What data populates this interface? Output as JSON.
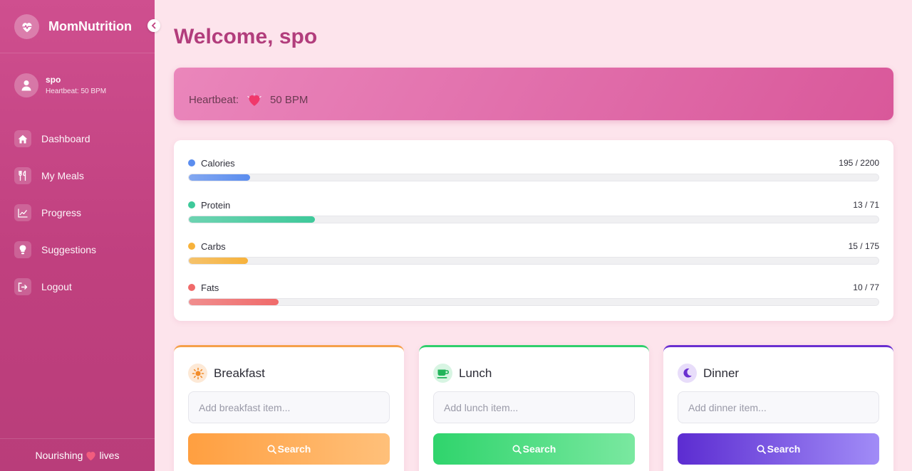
{
  "app": {
    "brand": "MomNutrition"
  },
  "user": {
    "name": "spo",
    "heartbeat_label": "Heartbeat: 50 BPM"
  },
  "nav": {
    "items": [
      {
        "label": "Dashboard",
        "icon": "home-icon"
      },
      {
        "label": "My Meals",
        "icon": "utensils-icon"
      },
      {
        "label": "Progress",
        "icon": "chart-line-icon"
      },
      {
        "label": "Suggestions",
        "icon": "lightbulb-icon"
      },
      {
        "label": "Logout",
        "icon": "logout-icon"
      }
    ]
  },
  "footer": {
    "left": "Nourishing",
    "right": "lives"
  },
  "main": {
    "welcome": "Welcome, spo",
    "heartbeat": {
      "label": "Heartbeat:",
      "value": "50 BPM"
    }
  },
  "nutrition": [
    {
      "name": "Calories",
      "value_text": "195 / 2200",
      "current": 195,
      "target": 2200,
      "color": "#5b8def"
    },
    {
      "name": "Protein",
      "value_text": "13 / 71",
      "current": 13,
      "target": 71,
      "color": "#3ec99a"
    },
    {
      "name": "Carbs",
      "value_text": "15 / 175",
      "current": 15,
      "target": 175,
      "color": "#f7b23b"
    },
    {
      "name": "Fats",
      "value_text": "10 / 77",
      "current": 10,
      "target": 77,
      "color": "#f06a6a"
    }
  ],
  "meals": [
    {
      "title": "Breakfast",
      "placeholder": "Add breakfast item...",
      "button": "Search",
      "accent": "#f5a04a",
      "icon": "sun-icon"
    },
    {
      "title": "Lunch",
      "placeholder": "Add lunch item...",
      "button": "Search",
      "accent": "#2fcf6c",
      "icon": "coffee-icon"
    },
    {
      "title": "Dinner",
      "placeholder": "Add dinner item...",
      "button": "Search",
      "accent": "#6a2fd0",
      "icon": "moon-icon"
    }
  ]
}
